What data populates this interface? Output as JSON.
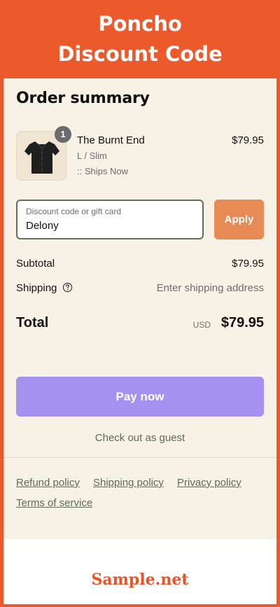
{
  "header": {
    "line1": "Poncho",
    "line2": "Discount Code"
  },
  "order": {
    "title": "Order summary",
    "item": {
      "quantity": "1",
      "name": "The Burnt End",
      "variant": "L / Slim",
      "shipping_note": ":: Ships Now",
      "price": "$79.95"
    }
  },
  "discount": {
    "placeholder": "Discount code or gift card",
    "value": "Delony",
    "apply_label": "Apply"
  },
  "summary": {
    "subtotal_label": "Subtotal",
    "subtotal_value": "$79.95",
    "shipping_label": "Shipping",
    "shipping_value": "Enter shipping address",
    "total_label": "Total",
    "currency": "USD",
    "total_value": "$79.95"
  },
  "actions": {
    "pay_label": "Pay now",
    "guest_label": "Check out as guest"
  },
  "policies": {
    "refund": "Refund policy",
    "shipping": "Shipping policy",
    "privacy": "Privacy policy",
    "terms": "Terms of service"
  },
  "footer": {
    "brand": "Sample.net"
  },
  "colors": {
    "brand_orange": "#ec5a2b",
    "panel_bg": "#f8f1e6",
    "apply_button": "#e88a55",
    "pay_button": "#a591ef",
    "link_green": "#5d6b57"
  },
  "icons": {
    "product_image": "shirt-thumbnail",
    "shipping_help": "question-circle-icon"
  }
}
